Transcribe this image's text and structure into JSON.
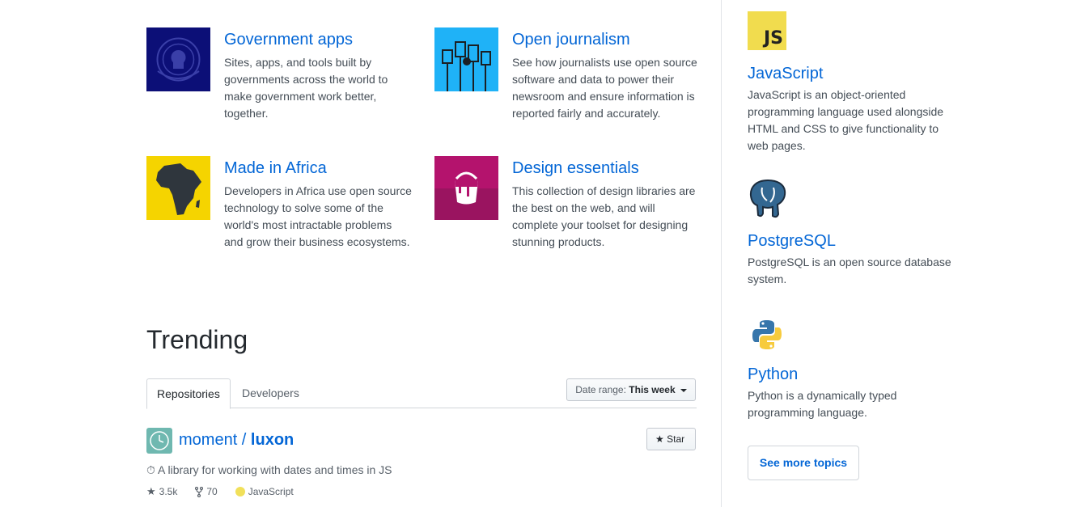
{
  "collections": [
    {
      "title": "Government apps",
      "desc": "Sites, apps, and tools built by governments across the world to make government work better, together."
    },
    {
      "title": "Open journalism",
      "desc": "See how journalists use open source software and data to power their newsroom and ensure information is reported fairly and accurately."
    },
    {
      "title": "Made in Africa",
      "desc": "Developers in Africa use open source technology to solve some of the world's most intractable problems and grow their business ecosystems."
    },
    {
      "title": "Design essentials",
      "desc": "This collection of design libraries are the best on the web, and will complete your toolset for designing stunning products."
    }
  ],
  "trending": {
    "title": "Trending",
    "tabs": [
      "Repositories",
      "Developers"
    ],
    "date_range_label": "Date range:",
    "date_range_value": "This week",
    "repo": {
      "owner": "moment",
      "separator": " / ",
      "name": "luxon",
      "description": "⏱ A library for working with dates and times in JS",
      "stars": "3.5k",
      "forks": "70",
      "language": "JavaScript",
      "language_color": "#f1e05a",
      "star_label": "Star"
    }
  },
  "topics": [
    {
      "name": "JavaScript",
      "icon": "js-logo-icon",
      "logo_text": "JS",
      "desc": "JavaScript is an object-oriented programming language used alongside HTML and CSS to give functionality to web pages."
    },
    {
      "name": "PostgreSQL",
      "icon": "postgresql-elephant-icon",
      "desc": "PostgreSQL is an open source database system."
    },
    {
      "name": "Python",
      "icon": "python-logo-icon",
      "desc": "Python is a dynamically typed programming language."
    }
  ],
  "see_more_label": "See more topics",
  "colors": {
    "link": "#0366d6",
    "gov_bg": "#0c0f77",
    "journalism_bg": "#1fb2f7",
    "africa_bg": "#f5d400",
    "design_bg": "#b4136d",
    "js_bg": "#f1dc4e"
  }
}
